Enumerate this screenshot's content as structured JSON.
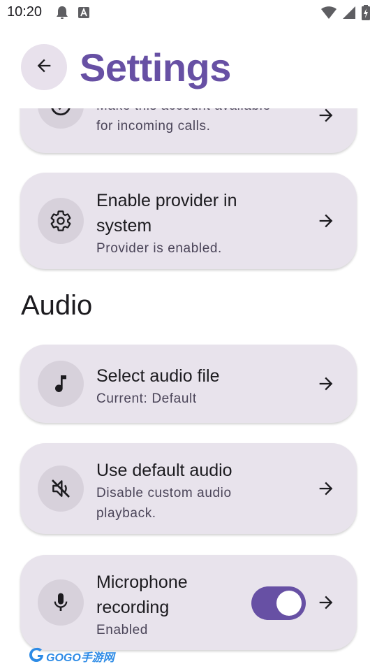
{
  "status_bar": {
    "time": "10:20"
  },
  "header": {
    "title": "Settings",
    "back_icon": "arrow-back-icon"
  },
  "cards": {
    "incoming_calls": {
      "subtitle_line1": "Make this account available",
      "subtitle_line2": "for incoming calls.",
      "icon": "check-circle-icon"
    },
    "enable_provider": {
      "title_line1": "Enable provider in",
      "title_line2": "system",
      "subtitle": "Provider is enabled.",
      "icon": "gear-icon"
    },
    "select_audio": {
      "title": "Select audio file",
      "subtitle": "Current: Default",
      "icon": "music-note-icon"
    },
    "default_audio": {
      "title": "Use default audio",
      "subtitle_line1": "Disable custom audio",
      "subtitle_line2": "playback.",
      "icon": "volume-off-icon"
    },
    "microphone": {
      "title_line1": "Microphone",
      "title_line2": "recording",
      "subtitle": "Enabled",
      "icon": "microphone-icon",
      "toggle_on": true
    }
  },
  "sections": {
    "audio": "Audio"
  },
  "colors": {
    "accent": "#6750A4",
    "card_bg": "#E8E3EC",
    "icon_bg": "#D7D1DB"
  },
  "watermark": {
    "text": "GOGO手游网"
  }
}
